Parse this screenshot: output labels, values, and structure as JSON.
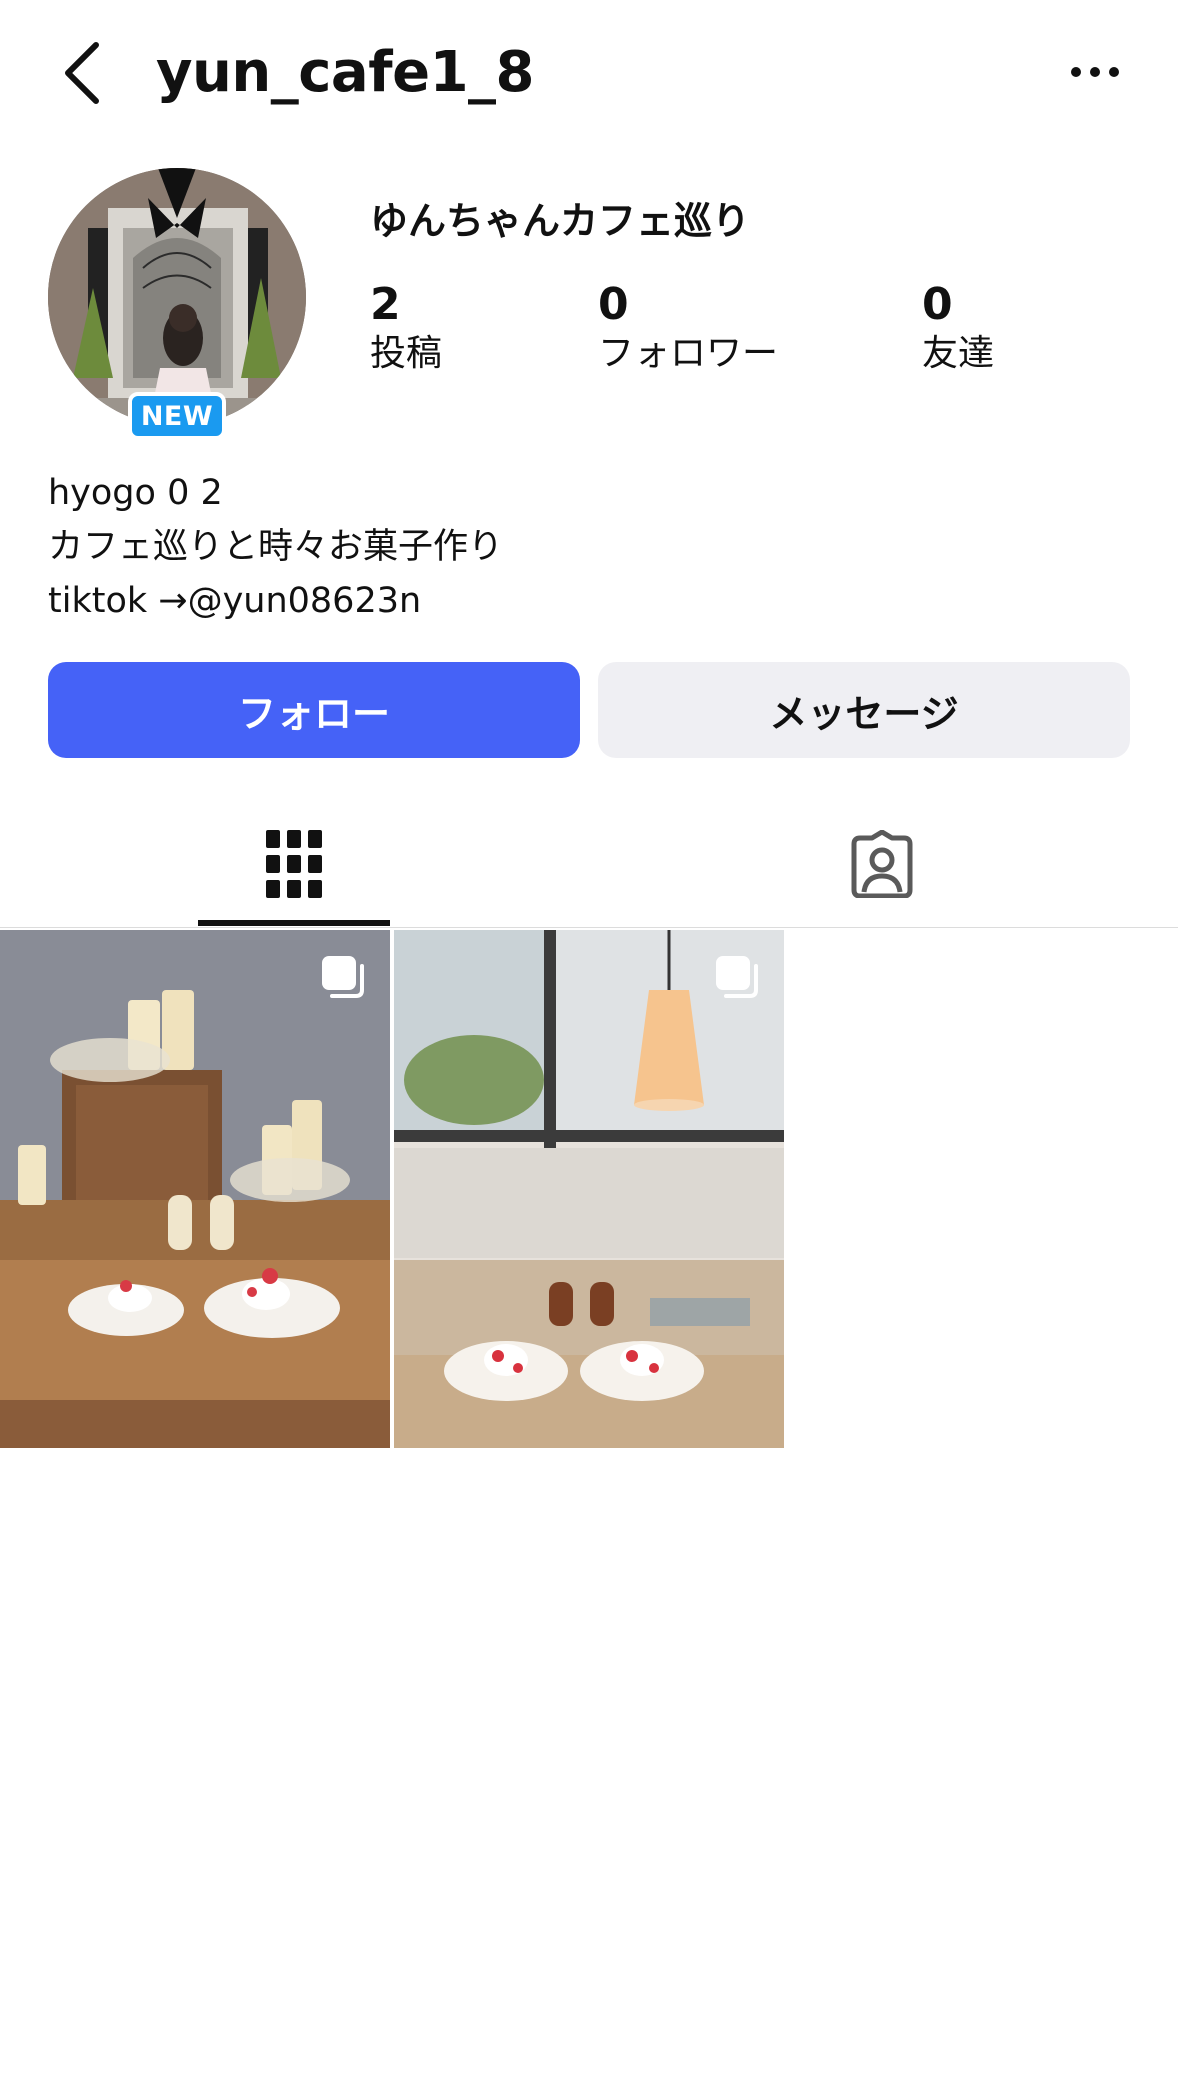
{
  "header": {
    "back_icon": "chevron-left-icon",
    "username": "yun_cafe1_8",
    "more_icon": "ellipsis-horizontal-icon"
  },
  "profile": {
    "avatar_badge": "NEW",
    "display_name": "ゆんちゃんカフェ巡り",
    "stats": [
      {
        "value": "2",
        "label": "投稿"
      },
      {
        "value": "0",
        "label": "フォロワー"
      },
      {
        "value": "0",
        "label": "友達"
      }
    ],
    "bio_lines": [
      "hyogo 0 2",
      "カフェ巡りと時々お菓子作り",
      "tiktok →@yun08623n"
    ]
  },
  "actions": {
    "follow_label": "フォロー",
    "message_label": "メッセージ"
  },
  "tabs": {
    "grid_icon": "grid-icon",
    "tagged_icon": "tagged-user-icon",
    "active": "grid"
  },
  "posts": [
    {
      "icon": "multiple-photos-icon"
    },
    {
      "icon": "multiple-photos-icon"
    }
  ],
  "colors": {
    "accent": "#4562f7",
    "badge": "#1a9af0",
    "secondary_button": "#efeff3"
  }
}
